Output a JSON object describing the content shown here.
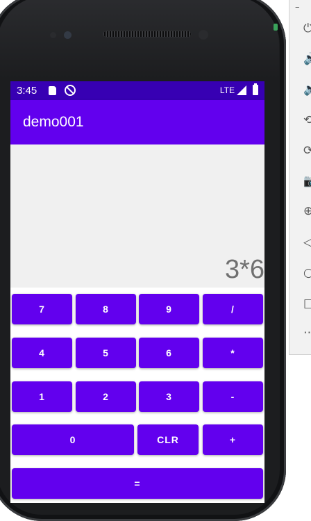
{
  "status_bar": {
    "time": "3:45",
    "network": "LTE",
    "icons": [
      "sd-card-icon",
      "do-not-disturb-icon",
      "signal-icon",
      "battery-icon"
    ]
  },
  "app_bar": {
    "title": "demo001"
  },
  "display": {
    "expression": "3*6"
  },
  "keypad": {
    "row1": [
      "7",
      "8",
      "9",
      "/"
    ],
    "row2": [
      "4",
      "5",
      "6",
      "*"
    ],
    "row3": [
      "1",
      "2",
      "3",
      "-"
    ],
    "row4": [
      "0",
      "CLR",
      "+"
    ],
    "row5": [
      "="
    ]
  },
  "emulator_toolbar": {
    "minimize": "–",
    "icons": [
      "power-icon",
      "volume-up-icon",
      "volume-down-icon",
      "rotate-left-icon",
      "rotate-right-icon",
      "screenshot-icon",
      "zoom-icon",
      "back-icon",
      "home-icon",
      "overview-icon",
      "more-icon"
    ]
  },
  "colors": {
    "status_bar": "#3700b3",
    "app_bar": "#6200ee",
    "button": "#6200ee",
    "display_bg": "#f0f0f0",
    "display_text": "#707070"
  }
}
